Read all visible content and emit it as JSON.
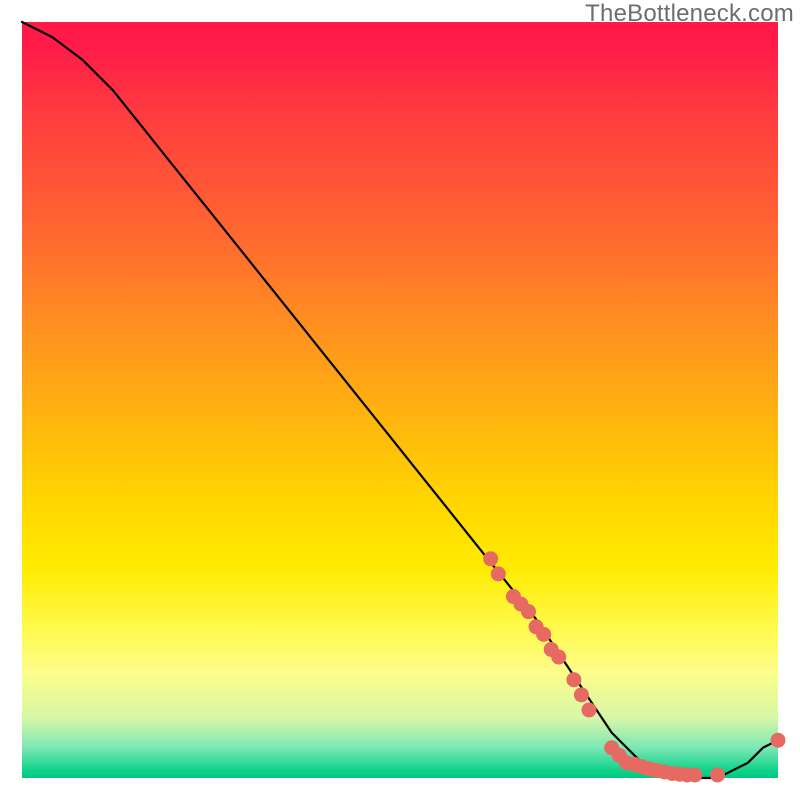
{
  "watermark": "TheBottleneck.com",
  "colors": {
    "curve": "#000000",
    "dots": "#e66a62",
    "gradient_top": "#ff1a4a",
    "gradient_bottom": "#00c87f"
  },
  "chart_data": {
    "type": "line",
    "title": "",
    "xlabel": "",
    "ylabel": "",
    "xlim": [
      0,
      100
    ],
    "ylim": [
      0,
      100
    ],
    "grid": false,
    "legend": false,
    "series": [
      {
        "name": "bottleneck-curve",
        "x": [
          0,
          4,
          8,
          12,
          16,
          20,
          24,
          28,
          32,
          36,
          40,
          44,
          48,
          52,
          56,
          60,
          64,
          68,
          70,
          72,
          74,
          76,
          78,
          80,
          82,
          84,
          86,
          88,
          90,
          92,
          94,
          96,
          98,
          100
        ],
        "values": [
          100,
          98,
          95,
          91,
          86,
          81,
          76,
          71,
          66,
          61,
          56,
          51,
          46,
          41,
          36,
          31,
          26,
          21,
          18,
          15,
          12,
          9,
          6,
          4,
          2,
          1,
          0,
          0,
          0,
          0,
          1,
          2,
          4,
          5
        ]
      }
    ],
    "markers": {
      "name": "highlighted-points",
      "x": [
        62,
        63,
        65,
        66,
        67,
        68,
        69,
        70,
        71,
        73,
        74,
        75,
        78,
        79,
        80,
        81,
        82,
        83,
        84,
        85,
        86,
        87,
        88,
        89,
        92,
        100
      ],
      "values": [
        29,
        27,
        24,
        23,
        22,
        20,
        19,
        17,
        16,
        13,
        11,
        9,
        4,
        3,
        2,
        1.8,
        1.5,
        1.2,
        1.0,
        0.8,
        0.6,
        0.5,
        0.4,
        0.4,
        0.4,
        5
      ]
    }
  }
}
